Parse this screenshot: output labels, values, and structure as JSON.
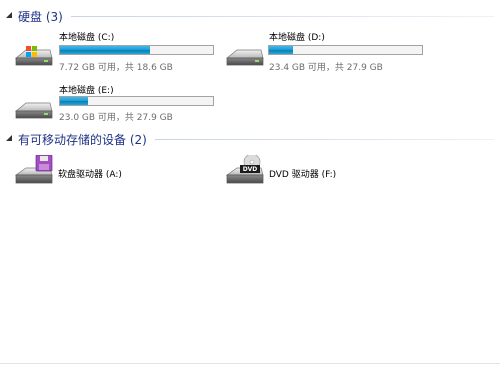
{
  "sections": {
    "hard_disks": {
      "title": "硬盘 (3)"
    },
    "removable": {
      "title": "有可移动存储的设备 (2)"
    }
  },
  "drives": [
    {
      "label": "本地磁盘 (C:)",
      "info": "7.72 GB 可用，共 18.6 GB",
      "used_fraction": 0.585
    },
    {
      "label": "本地磁盘 (D:)",
      "info": "23.4 GB 可用，共 27.9 GB",
      "used_fraction": 0.16
    },
    {
      "label": "本地磁盘 (E:)",
      "info": "23.0 GB 可用，共 27.9 GB",
      "used_fraction": 0.18
    }
  ],
  "devices": [
    {
      "label": "软盘驱动器 (A:)",
      "icon": "floppy-drive-icon"
    },
    {
      "label": "DVD 驱动器 (F:)",
      "icon": "dvd-drive-icon",
      "badge": "DVD"
    }
  ],
  "colors": {
    "section_title": "#1e3287",
    "bar_fill": "#26a6da",
    "info_text": "#6d6d6d"
  }
}
